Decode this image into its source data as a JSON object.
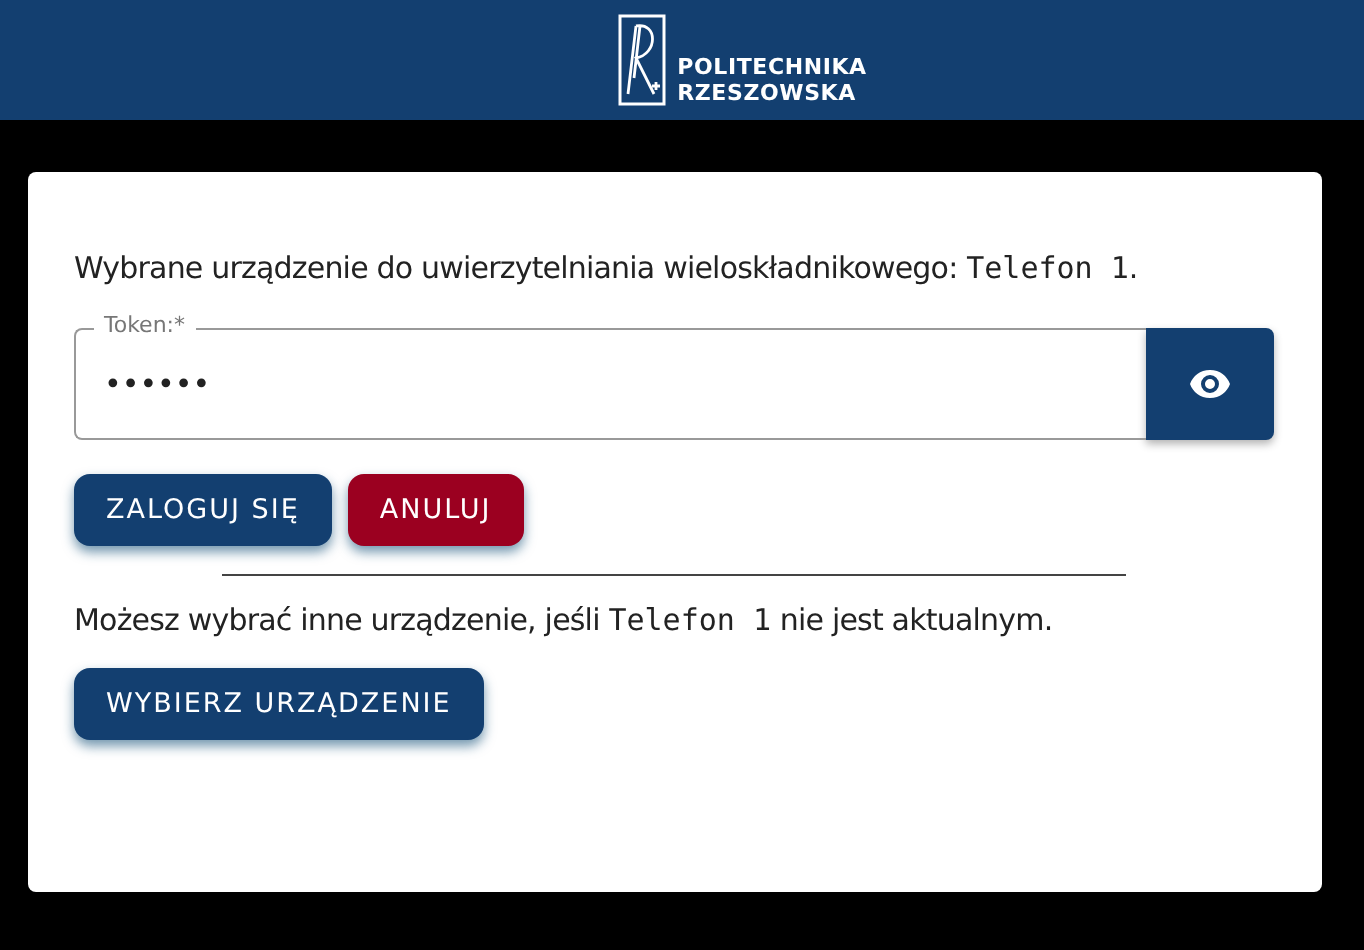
{
  "header": {
    "logo_lines": [
      "POLITECHNIKA",
      "RZESZOWSKA"
    ]
  },
  "message": {
    "before": "Wybrane urządzenie do uwierzytelniania wieloskładnikowego: ",
    "device": "Telefon 1",
    "after": "."
  },
  "token_field": {
    "label": "Token:*",
    "value": "••••••"
  },
  "buttons": [
    {
      "label": "ZALOGUJ SIĘ",
      "kind": "primary"
    },
    {
      "label": "ANULUJ",
      "kind": "danger"
    }
  ],
  "hint": {
    "before": "Możesz wybrać inne urządzenie, jeśli ",
    "device": "Telefon 1",
    "after": " nie jest aktualnym."
  },
  "choose_button": {
    "label": "WYBIERZ URZĄDZENIE",
    "kind": "primary"
  }
}
